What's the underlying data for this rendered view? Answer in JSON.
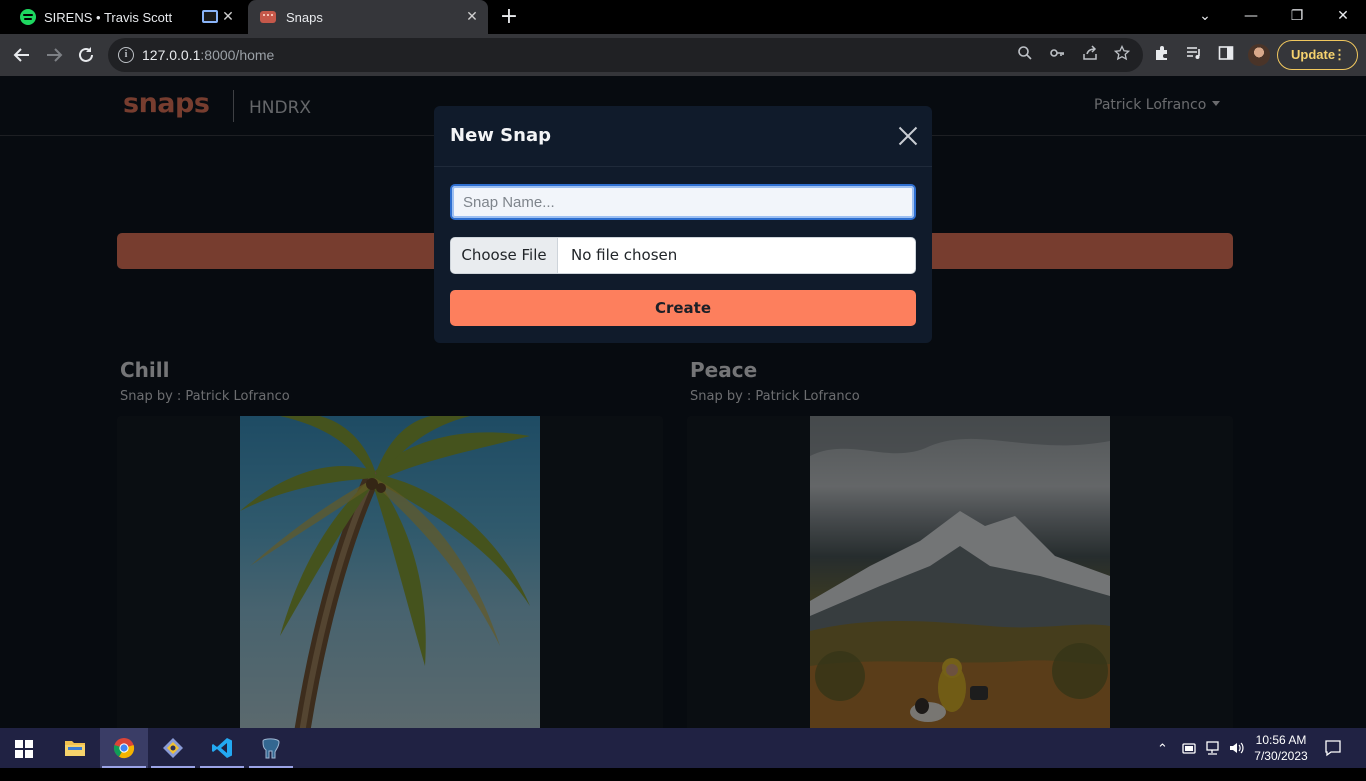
{
  "browser": {
    "tabs": [
      {
        "title": "SIRENS • Travis Scott",
        "close": "✕"
      },
      {
        "title": "Snaps",
        "close": "✕"
      }
    ],
    "new_tab_glyph": "+",
    "url_host": "127.0.0.1",
    "url_rest": ":8000/home",
    "update_label": "Update",
    "window_controls": {
      "collapse": "⌄",
      "minimize": "—",
      "restore": "❐",
      "close": "✕"
    }
  },
  "app": {
    "brand": "snaps",
    "subtitle": "HNDRX",
    "user_menu": "Patrick Lofranco",
    "accent_color": "#ef7b5e",
    "snaps": [
      {
        "title": "Chill",
        "author_line": "Snap by : Patrick Lofranco"
      },
      {
        "title": "Peace",
        "author_line": "Snap by : Patrick Lofranco"
      }
    ]
  },
  "modal": {
    "title": "New Snap",
    "name_placeholder": "Snap Name...",
    "file_button": "Choose File",
    "file_status": "No file chosen",
    "submit_label": "Create"
  },
  "taskbar": {
    "time": "10:56 AM",
    "date": "7/30/2023"
  }
}
